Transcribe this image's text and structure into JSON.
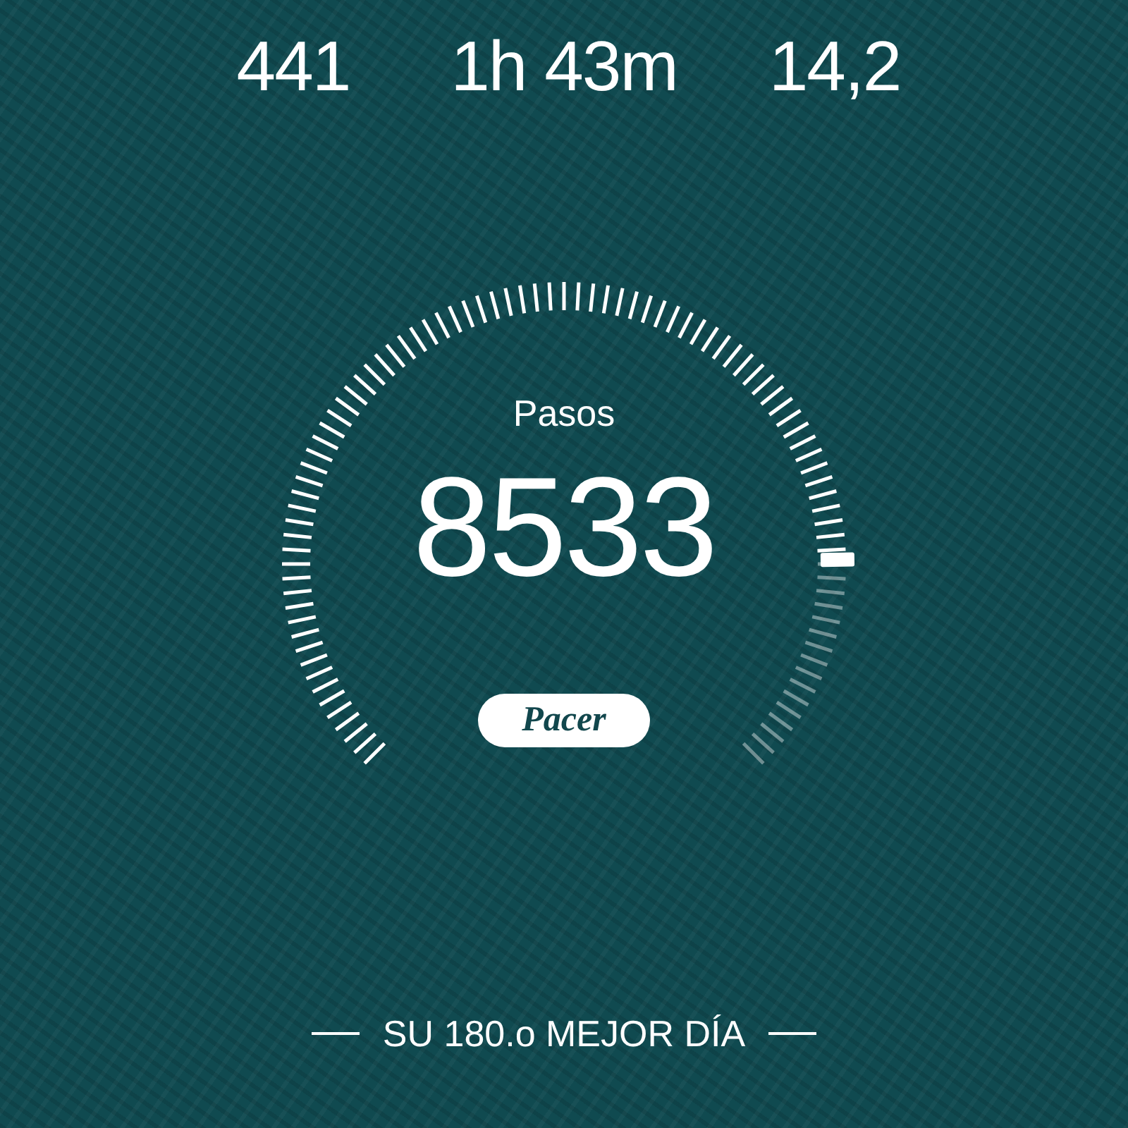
{
  "stats": [
    {
      "value": "441"
    },
    {
      "value": "1h 43m"
    },
    {
      "value": "14,2"
    }
  ],
  "steps": {
    "label": "Pasos",
    "value": "8533"
  },
  "logo": {
    "text": "Pacer"
  },
  "footer": {
    "text": "SU 180.o MEJOR DÍA"
  }
}
